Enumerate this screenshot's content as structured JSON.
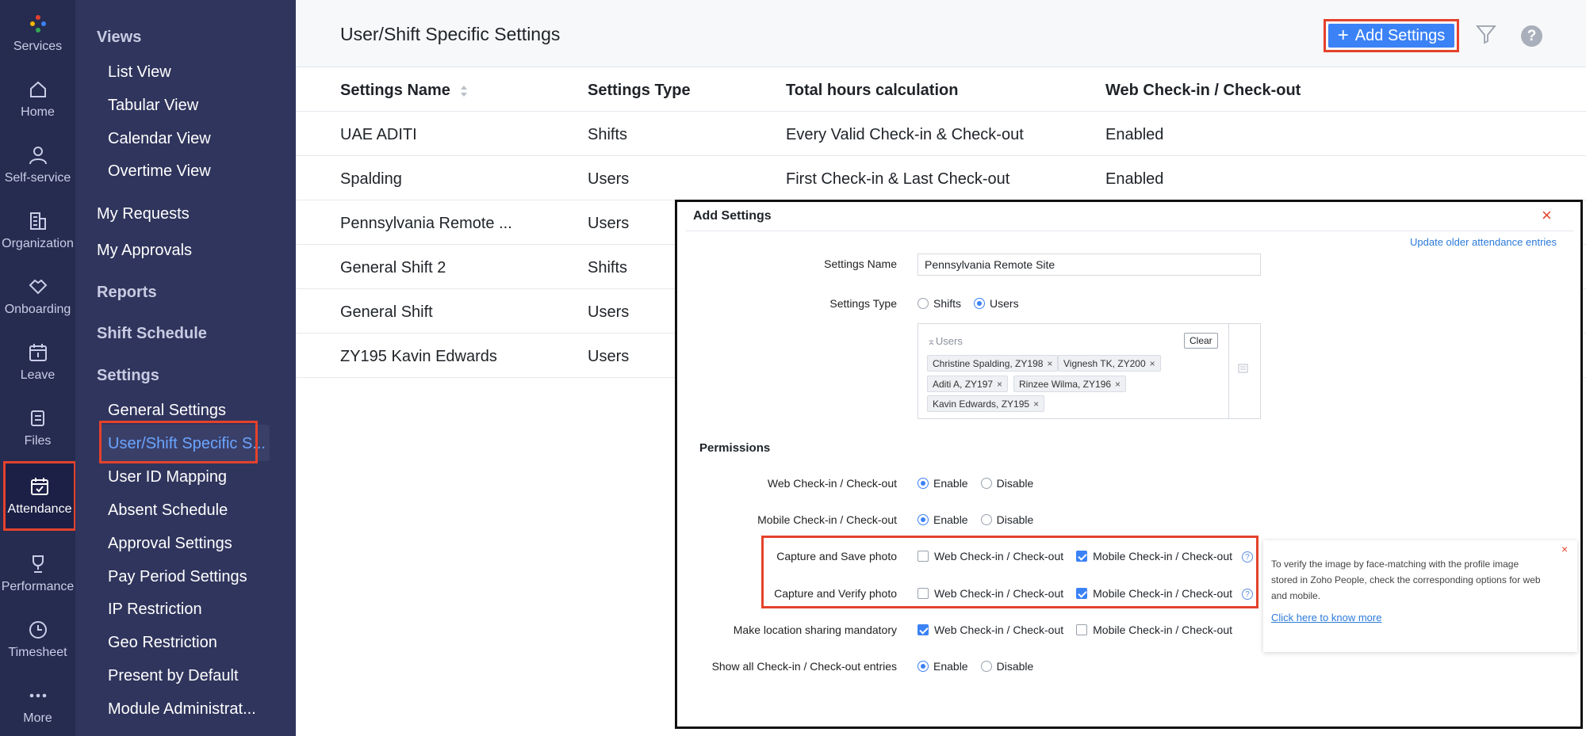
{
  "rail": {
    "items": [
      {
        "label": "Services",
        "icon": "services-icon"
      },
      {
        "label": "Home",
        "icon": "home-icon"
      },
      {
        "label": "Self-service",
        "icon": "person-icon"
      },
      {
        "label": "Organization",
        "icon": "building-icon"
      },
      {
        "label": "Onboarding",
        "icon": "handshake-icon"
      },
      {
        "label": "Leave",
        "icon": "calendar-icon"
      },
      {
        "label": "Files",
        "icon": "files-icon"
      },
      {
        "label": "Attendance",
        "icon": "calendar-check-icon"
      },
      {
        "label": "Performance",
        "icon": "trophy-icon"
      },
      {
        "label": "Timesheet",
        "icon": "clock-icon"
      },
      {
        "label": "More",
        "icon": "more-icon"
      }
    ]
  },
  "nav": {
    "views": "Views",
    "list_view": "List View",
    "tabular_view": "Tabular View",
    "calendar_view": "Calendar View",
    "overtime_view": "Overtime View",
    "my_requests": "My Requests",
    "my_approvals": "My Approvals",
    "reports": "Reports",
    "shift_schedule": "Shift Schedule",
    "settings": "Settings",
    "settings_items": [
      "General Settings",
      "User/Shift Specific S...",
      "User ID Mapping",
      "Absent Schedule",
      "Approval Settings",
      "Pay Period Settings",
      "IP Restriction",
      "Geo Restriction",
      "Present by Default",
      "Module Administrat..."
    ]
  },
  "header": {
    "title": "User/Shift Specific Settings",
    "add_button": "Add Settings",
    "help": "?"
  },
  "table": {
    "columns": [
      "Settings Name",
      "Settings Type",
      "Total hours calculation",
      "Web Check-in / Check-out"
    ],
    "rows": [
      [
        "UAE ADITI",
        "Shifts",
        "Every Valid Check-in & Check-out",
        "Enabled"
      ],
      [
        "Spalding",
        "Users",
        "First Check-in & Last Check-out",
        "Enabled"
      ],
      [
        "Pennsylvania Remote ...",
        "Users",
        "",
        ""
      ],
      [
        "General Shift 2",
        "Shifts",
        "",
        ""
      ],
      [
        "General Shift",
        "Users",
        "",
        ""
      ],
      [
        "ZY195 Kavin Edwards",
        "Users",
        "",
        ""
      ]
    ]
  },
  "modal": {
    "title": "Add Settings",
    "close": "×",
    "update_link": "Update older attendance entries",
    "settings_name_label": "Settings Name",
    "settings_name_value": "Pennsylvania Remote Site",
    "settings_type_label": "Settings Type",
    "type_shifts": "Shifts",
    "type_users": "Users",
    "users_label": "Users",
    "clear": "Clear",
    "chips": [
      "Christine Spalding, ZY198",
      "Vignesh TK, ZY200",
      "Aditi A, ZY197",
      "Rinzee Wilma, ZY196",
      "Kavin Edwards, ZY195"
    ],
    "permissions_title": "Permissions",
    "enable": "Enable",
    "disable": "Disable",
    "web": "Web Check-in / Check-out",
    "mobile": "Mobile Check-in / Check-out",
    "web_checkin_label": "Web Check-in / Check-out",
    "mobile_checkin_label": "Mobile Check-in / Check-out",
    "capture_save_label": "Capture and Save photo",
    "capture_verify_label": "Capture and Verify photo",
    "location_label": "Make location sharing mandatory",
    "show_all_label": "Show all Check-in / Check-out entries",
    "tooltip_text": "To verify the image by face-matching with the profile image stored in Zoho People, check the corresponding options for web and mobile.",
    "tooltip_link": "Click here to know more",
    "tooltip_close": "×"
  },
  "colors": {
    "accent": "#3b82f6",
    "highlight": "#e4422c",
    "rail": "#262b50",
    "nav": "#30355d"
  }
}
